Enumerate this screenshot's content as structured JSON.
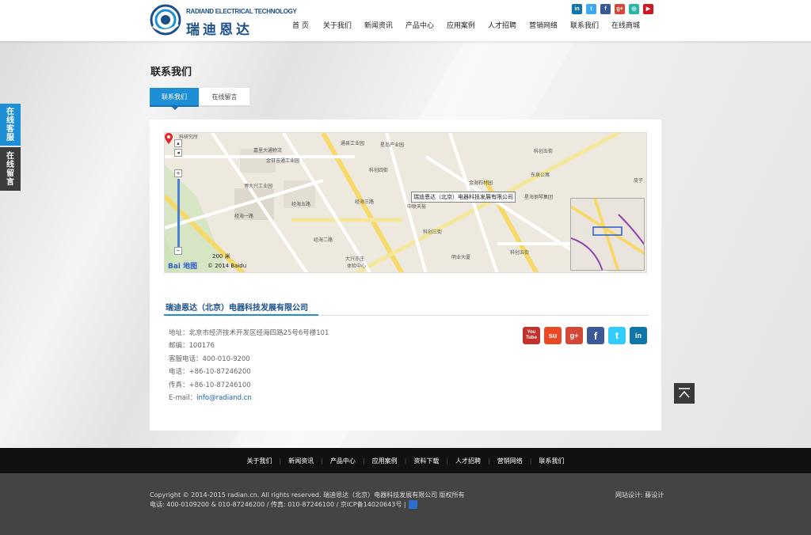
{
  "header": {
    "logo_en": "RADIAND ELECTRICAL TECHNOLOGY",
    "logo_cn": "瑞迪恩达",
    "nav": [
      "首 页",
      "关于我们",
      "新闻资讯",
      "产品中心",
      "应用案例",
      "人才招聘",
      "营销网络",
      "联系我们",
      "在线商城"
    ],
    "social": [
      {
        "icon": "linkedin-icon",
        "glyph": "in",
        "color": "#0e76a8"
      },
      {
        "icon": "twitter-icon",
        "glyph": "t",
        "color": "#3fa9f5"
      },
      {
        "icon": "facebook-icon",
        "glyph": "f",
        "color": "#3b5998"
      },
      {
        "icon": "google-plus-icon",
        "glyph": "g+",
        "color": "#d34836"
      },
      {
        "icon": "wechat-icon",
        "glyph": "◎",
        "color": "#2bb5a5"
      },
      {
        "icon": "youtube-icon",
        "glyph": "▶",
        "color": "#cc181e"
      }
    ]
  },
  "side": {
    "online_service": [
      "在",
      "线",
      "客",
      "服"
    ],
    "online_message": [
      "在",
      "线",
      "留",
      "言"
    ]
  },
  "main": {
    "title": "联系我们",
    "tabs": [
      "联系我们",
      "在线留言"
    ],
    "map": {
      "popup": "瑞迪恩达（北京）电器科技发展有限公司",
      "scale": "200 米",
      "brand": "Bai 地图",
      "copyright": "© 2014 Baidu",
      "labels": {
        "l1": "科研究所",
        "l2": "嘉里大通物流",
        "l3": "金日吉通工业园",
        "l4": "博大兴工业园",
        "l5": "经海一路",
        "l6": "通县工业园",
        "l7": "星岛产业园",
        "l8": "科创四街",
        "l9": "经海三路",
        "l10": "中联天裕",
        "l11": "金海石材园",
        "l12": "东泉公寓",
        "l13": "科创五街",
        "l14": "星海钢琴集团",
        "l15": "大兴亦庄",
        "l16": "体检中心",
        "l17": "明业大厦",
        "l18": "经海二路",
        "l19": "科创三街",
        "l20": "皮子",
        "l21": "经海五路",
        "l22": "科创五街"
      }
    },
    "company": "瑞迪恩达（北京）电器科技发展有限公司",
    "info": [
      "地址：北京市经济技术开发区经海四路25号6号楼101",
      "邮编：100176",
      "客服电话：400-010-9200",
      "电话：+86-10-87246200",
      "传真：+86-10-87246100"
    ],
    "email_label": "E-mail：",
    "email": "info@radiand.cn",
    "social_big": [
      {
        "icon": "youtube-icon",
        "glyph": "You Tube",
        "color": "#c4302b"
      },
      {
        "icon": "stumbleupon-icon",
        "glyph": "su",
        "color": "#eb4924"
      },
      {
        "icon": "google-plus-icon",
        "glyph": "g+",
        "color": "#d34836"
      },
      {
        "icon": "facebook-icon",
        "glyph": "f",
        "color": "#3b5998"
      },
      {
        "icon": "twitter-icon",
        "glyph": "t",
        "color": "#33ccff"
      },
      {
        "icon": "linkedin-icon",
        "glyph": "in",
        "color": "#0e76a8"
      }
    ]
  },
  "footer": {
    "nav": [
      "关于我们",
      "新闻资讯",
      "产品中心",
      "应用案例",
      "资料下载",
      "人才招聘",
      "营销网络",
      "联系我们"
    ],
    "copyright": "Copyright © 2014-2015 radian.cn. All rights reserved. 瑞迪恩达（北京）电器科技发展有限公司 版权所有",
    "contact": "电话: 400-0109200 & 010-87246200  /  传真: 010-87246100  /  京ICP备14020643号 |",
    "design": "网站设计: 藤设计"
  },
  "colors": {
    "accent": "#1d8fd6",
    "brand": "#1b4f8a",
    "side_tab_blue": "#1d8fd6",
    "side_tab_dark": "#3c3c3c"
  }
}
